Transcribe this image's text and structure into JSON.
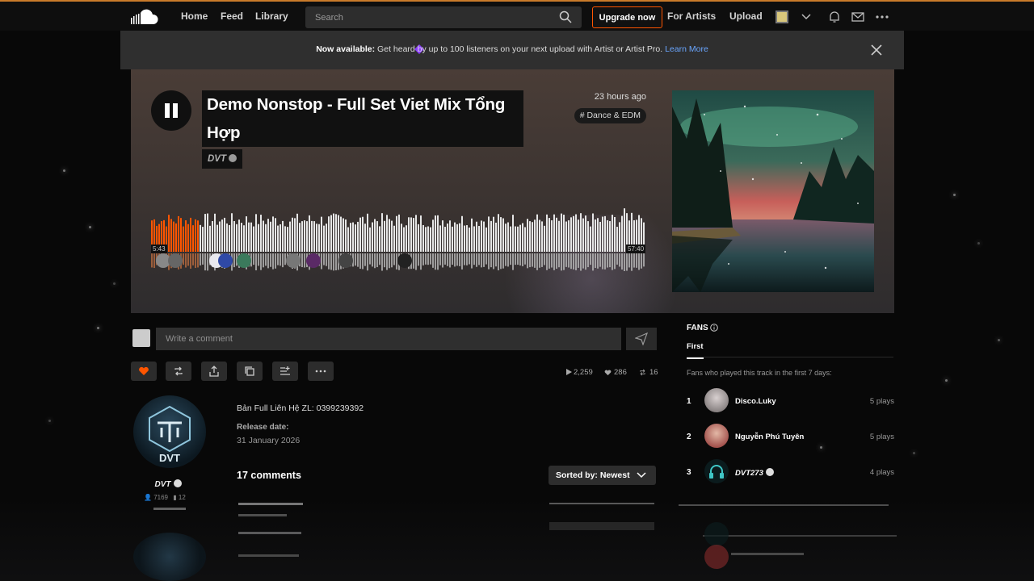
{
  "nav": {
    "home": "Home",
    "feed": "Feed",
    "library": "Library",
    "search_placeholder": "Search",
    "upgrade": "Upgrade now",
    "for_artists": "For Artists",
    "upload": "Upload"
  },
  "banner": {
    "strong": "Now available:",
    "text": " Get heard by up to 100 listeners on your next upload with Artist or Artist Pro. ",
    "link": "Learn More"
  },
  "track": {
    "title": "Demo Nonstop - Full Set Viet Mix Tổng Hợp",
    "artist": "DVT",
    "posted": "23 hours ago",
    "genre": "# Dance & EDM",
    "time_elapsed": "5:43",
    "time_total": "57:40",
    "progress": 0.1
  },
  "comment": {
    "placeholder": "Write a comment"
  },
  "stats": {
    "plays": "2,259",
    "likes": "286",
    "reposts": "16"
  },
  "artist": {
    "name": "DVT",
    "logo_text": "DVT",
    "followers": "7169",
    "tracks": "12"
  },
  "description": "Bản Full Liên Hệ ZL: 0399239392",
  "release": {
    "label": "Release date:",
    "date": "31 January 2026"
  },
  "comments": {
    "count": "17 comments",
    "sort": "Sorted by: Newest"
  },
  "fans": {
    "title": "FANS",
    "tab": "First",
    "subtitle": "Fans who played this track in the first 7 days:",
    "list": [
      {
        "rank": "1",
        "name": "Disco.Luky",
        "plays": "5 plays"
      },
      {
        "rank": "2",
        "name": "Nguyễn Phú Tuyên",
        "plays": "5 plays"
      },
      {
        "rank": "3",
        "name": "DVT273",
        "plays": "4 plays"
      }
    ]
  },
  "colors": {
    "accent": "#ff5500",
    "banner_bg": "#2f2f2f",
    "link": "#6aa6ff"
  }
}
